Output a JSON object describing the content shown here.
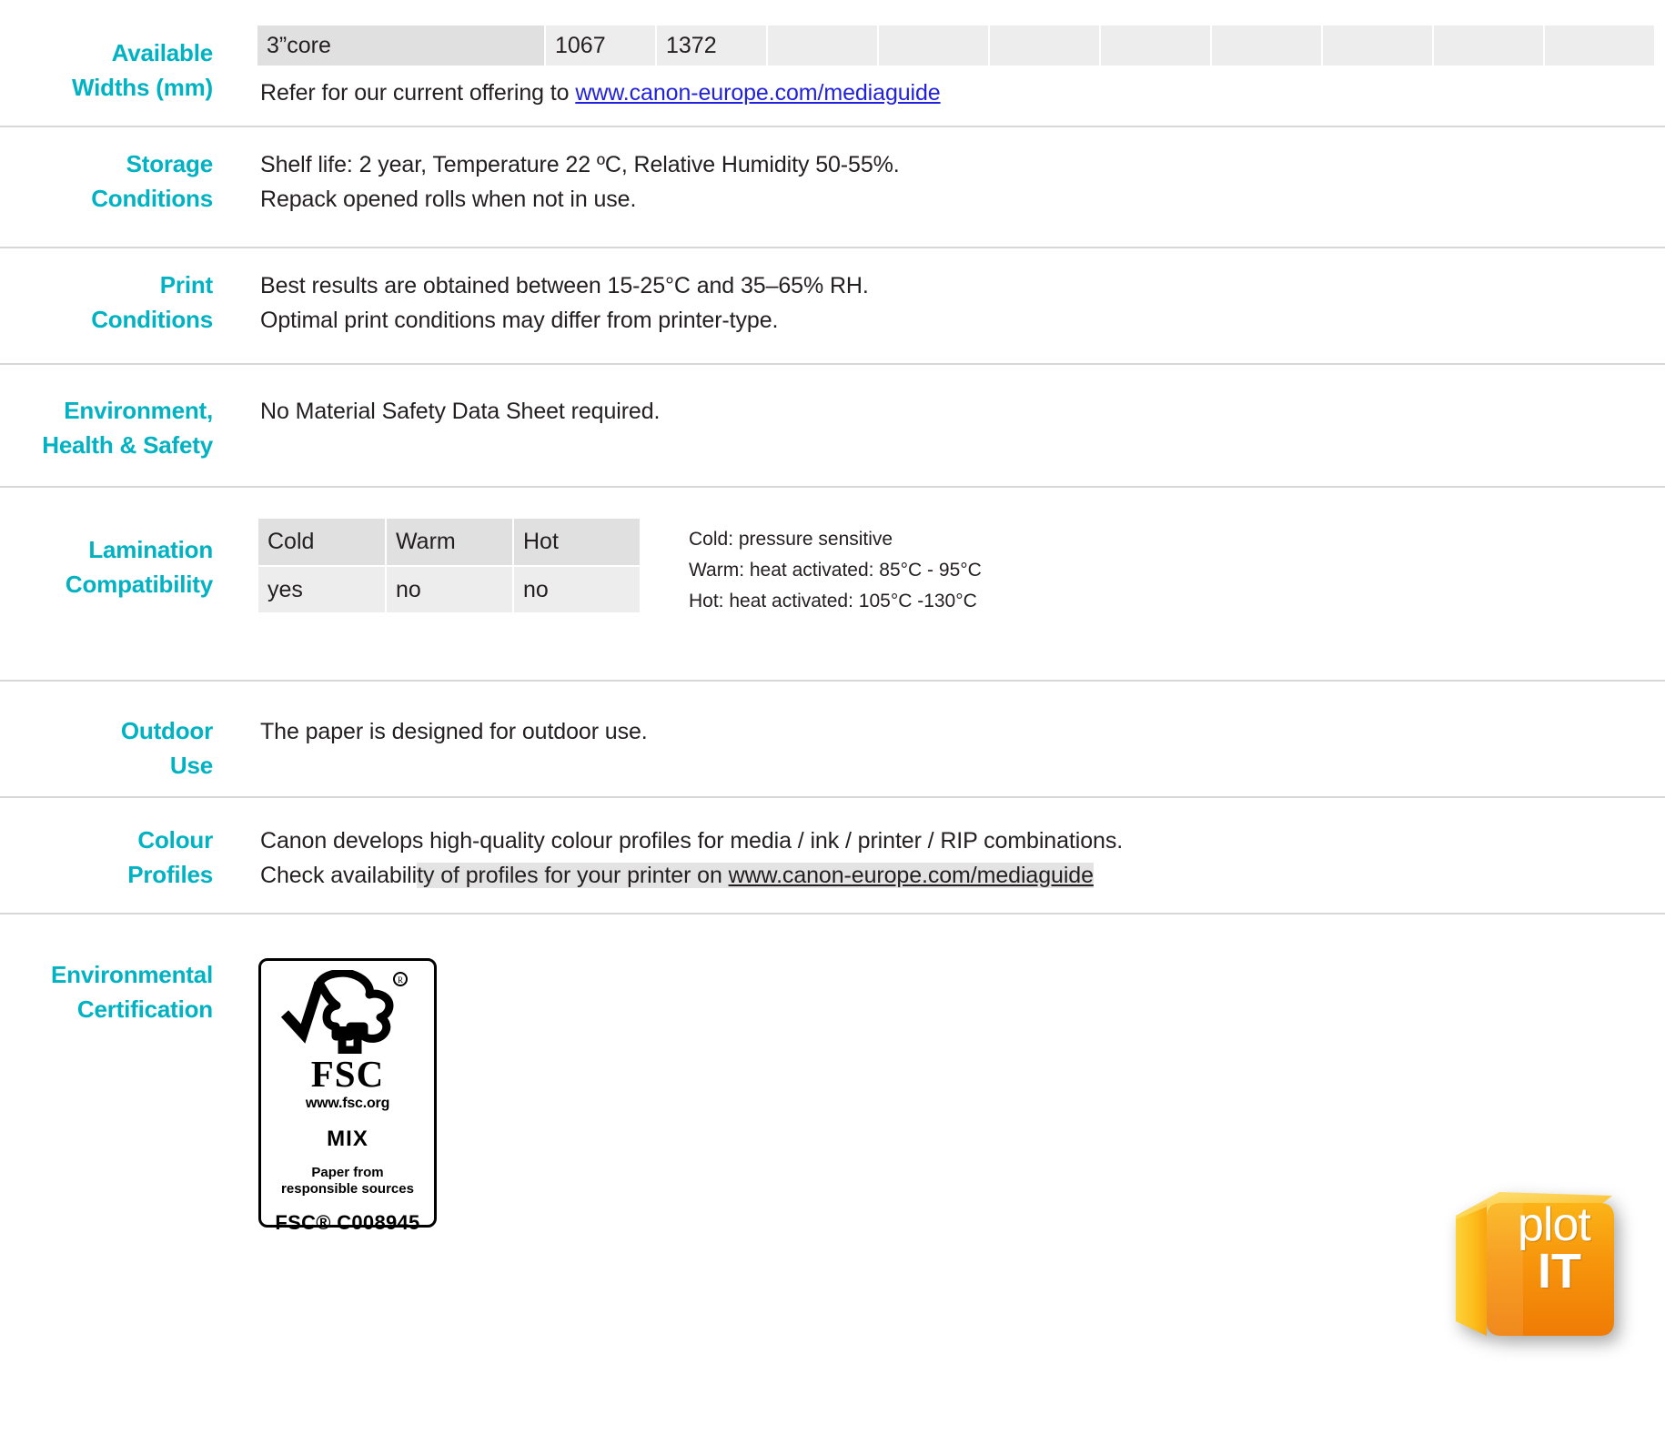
{
  "colors": {
    "label_teal": "#00b2c2",
    "link_blue": "#2222dd",
    "rule_gray": "#d7d7d7",
    "cell_gray": "#ededed",
    "cell_gray_dark": "#e0e0e0",
    "highlight_gray": "#e3e3e3",
    "logo_orange": "#f59a0b"
  },
  "sections": {
    "available_widths": {
      "label_line1": "Available",
      "label_line2": "Widths (mm)",
      "table": {
        "cells": [
          "3”core",
          "1067",
          "1372",
          "",
          "",
          "",
          "",
          "",
          "",
          "",
          ""
        ]
      },
      "note_prefix": "Refer for our current offering to ",
      "note_link": "www.canon-europe.com/mediaguide"
    },
    "storage_conditions": {
      "label_line1": "Storage",
      "label_line2": "Conditions",
      "line1": "Shelf life: 2 year, Temperature 22 ºC, Relative Humidity 50-55%.",
      "line2": "Repack opened rolls when not in use."
    },
    "print_conditions": {
      "label_line1": "Print",
      "label_line2": "Conditions",
      "line1": "Best results are obtained between 15-25°C and 35–65% RH.",
      "line2": "Optimal print conditions may differ from printer-type."
    },
    "environment_health_safety": {
      "label_line1": "Environment,",
      "label_line2": "Health & Safety",
      "line1": "No Material Safety Data Sheet required."
    },
    "lamination": {
      "label_line1": "Lamination",
      "label_line2": "Compatibility",
      "headers": [
        "Cold",
        "Warm",
        "Hot"
      ],
      "values": [
        "yes",
        "no",
        "no"
      ],
      "notes": [
        "Cold: pressure sensitive",
        "Warm: heat activated: 85°C - 95°C",
        "Hot: heat activated: 105°C -130°C"
      ]
    },
    "outdoor_use": {
      "label_line1": "Outdoor",
      "label_line2": "Use",
      "line1": "The paper is designed for outdoor use."
    },
    "colour_profiles": {
      "label_line1": "Colour",
      "label_line2": "Profiles",
      "line1": "Canon develops high-quality colour profiles for media / ink / printer / RIP combinations.",
      "line2_a": "Check availabili",
      "line2_b": "ty of profiles for your printer on ",
      "line2_link": "www.canon-europe.com/mediaguide"
    },
    "environmental_certification": {
      "label_line1": "Environmental",
      "label_line2": "Certification",
      "fsc": {
        "name": "FSC",
        "url": "www.fsc.org",
        "mix": "MIX",
        "desc_line1": "Paper from",
        "desc_line2": "responsible sources",
        "code": "FSC® C008945",
        "registered_mark": "®"
      }
    }
  },
  "brand_logo": {
    "line1": "plot",
    "line2": "IT"
  }
}
